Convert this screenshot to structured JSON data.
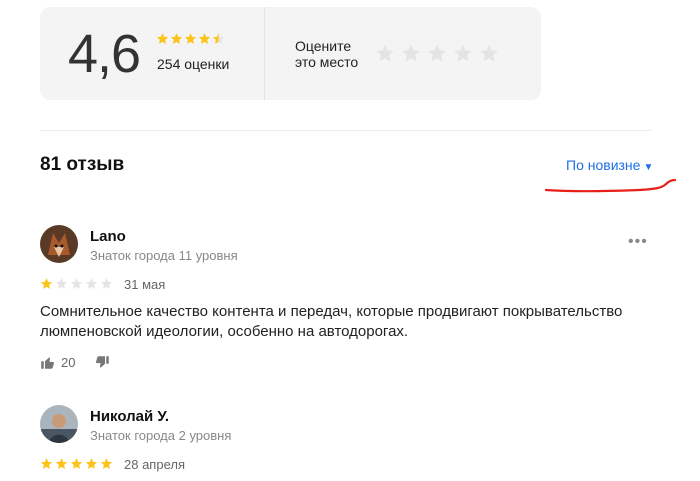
{
  "rating": {
    "score": "4,6",
    "count_label": "254 оценки",
    "stars_filled": 4.5,
    "rate_prompt": "Оцените это место"
  },
  "reviews_header": {
    "count_label": "81 отзыв",
    "sort_label": "По новизне"
  },
  "colors": {
    "star_filled": "#fcc419",
    "star_empty": "#e4e4e4",
    "link": "#1e6fe6",
    "annotation": "#e8201a"
  },
  "reviews": [
    {
      "author": "Lano",
      "level": "Знаток города 11 уровня",
      "stars": 1,
      "date": "31 мая",
      "text": "Сомнительное качество контента и передач, которые продвигают покрывательство люмпеновской идеологии, особенно на автодорогах.",
      "likes": "20",
      "avatar_icon": "fox-avatar-icon"
    },
    {
      "author": "Николай У.",
      "level": "Знаток города 2 уровня",
      "stars": 5,
      "date": "28 апреля",
      "avatar_icon": "person-avatar-icon"
    }
  ]
}
